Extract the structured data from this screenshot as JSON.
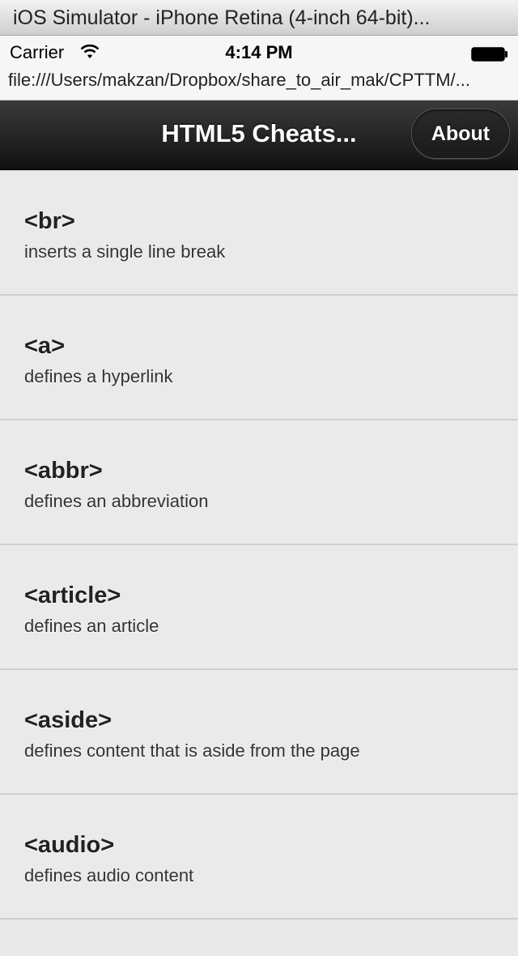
{
  "window": {
    "title": "iOS Simulator - iPhone Retina (4-inch 64-bit)..."
  },
  "status_bar": {
    "carrier": "Carrier",
    "time": "4:14 PM",
    "icons": [
      "wifi-icon",
      "battery-icon"
    ]
  },
  "url_bar": {
    "url": "file:///Users/makzan/Dropbox/share_to_air_mak/CPTTM/..."
  },
  "header": {
    "title": "HTML5 Cheats...",
    "about_label": "About"
  },
  "items": [
    {
      "tag": "<br>",
      "description": "inserts a single line break"
    },
    {
      "tag": "<a>",
      "description": "defines a hyperlink"
    },
    {
      "tag": "<abbr>",
      "description": "defines an abbreviation"
    },
    {
      "tag": "<article>",
      "description": "defines an article"
    },
    {
      "tag": "<aside>",
      "description": "defines content that is aside from the page"
    },
    {
      "tag": "<audio>",
      "description": "defines audio content"
    }
  ],
  "colors": {
    "header_bg": "#1a1a1a",
    "list_bg": "#eaeaea",
    "divider": "#cfcfcf"
  }
}
